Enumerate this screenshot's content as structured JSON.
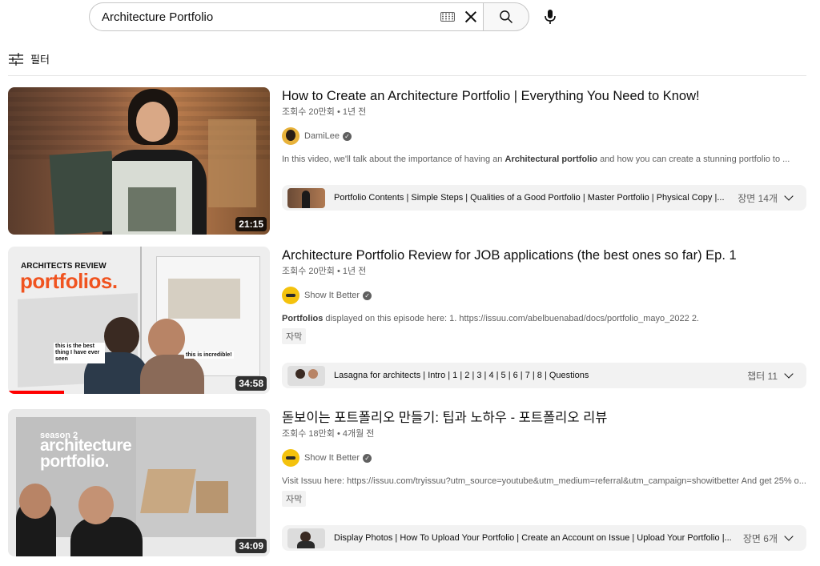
{
  "search": {
    "query": "Architecture Portfolio",
    "icons": {
      "keyboard": "keyboard-icon",
      "clear": "close-icon",
      "search": "search-icon",
      "mic": "microphone-icon"
    }
  },
  "filter": {
    "label": "필터",
    "icon": "sliders-icon"
  },
  "results": [
    {
      "title": "How to Create an Architecture Portfolio | Everything You Need to Know!",
      "meta": "조회수 20만회 • 1년 전",
      "channel": "DamiLee",
      "description_pre": "In this video, we'll talk about the importance of having an ",
      "description_bold": "Architectural portfolio",
      "description_post": " and how you can create a stunning portfolio to ...",
      "duration": "21:15",
      "chapters_text": "Portfolio Contents | Simple Steps | Qualities of a Good Portfolio | Master Portfolio | Physical Copy |...",
      "chapters_count": "장면 14개"
    },
    {
      "title": "Architecture Portfolio Review for JOB applications (the best ones so far) Ep. 1",
      "meta": "조회수 20만회 • 1년 전",
      "channel": "Show It Better",
      "description_bold": "Portfolios",
      "description_post": " displayed on this episode here: 1. https://issuu.com/abelbuenabad/docs/portfolio_mayo_2022 2.",
      "cc": "자막",
      "duration": "34:58",
      "thumb_heading": "ARCHITECTS REVIEW",
      "thumb_big": "portfolios.",
      "thumb_caption_1": "this is the best thing I have ever seen",
      "thumb_caption_2": "this is incredible!",
      "chapters_text": "Lasagna for architects | Intro | 1 | 2 | 3 | 4 | 5 | 6 | 7 | 8 | Questions",
      "chapters_count": "챕터 11"
    },
    {
      "title": "돋보이는 포트폴리오 만들기: 팁과 노하우 - 포트폴리오 리뷰",
      "meta": "조회수 18만회 • 4개월 전",
      "channel": "Show It Better",
      "description_post": "Visit Issuu here: https://issuu.com/tryissuu?utm_source=youtube&utm_medium=referral&utm_campaign=showitbetter And get 25% o...",
      "cc": "자막",
      "duration": "34:09",
      "thumb_heading": "season 2",
      "thumb_big_1": "architecture",
      "thumb_big_2": "portfolio.",
      "chapters_text": "Display Photos | How To Upload Your Portfolio | Create an Account on Issue | Upload Your Portfolio |...",
      "chapters_count": "장면 6개"
    }
  ],
  "colors": {
    "accent_red": "#ff0000",
    "orange": "#f0531f"
  }
}
